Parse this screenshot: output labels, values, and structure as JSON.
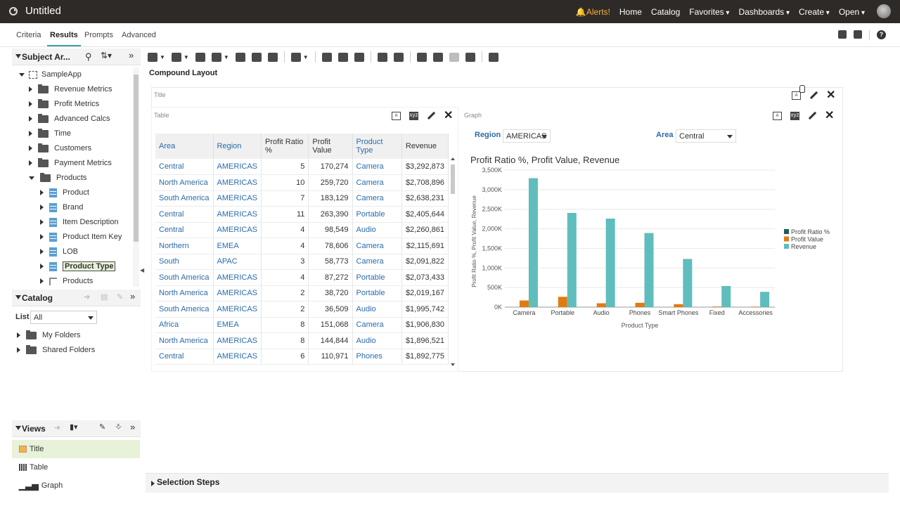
{
  "app": {
    "title": "Untitled"
  },
  "topnav": {
    "alerts": "Alerts!",
    "home": "Home",
    "catalog": "Catalog",
    "favorites": "Favorites",
    "dashboards": "Dashboards",
    "create": "Create",
    "open": "Open"
  },
  "tabs": [
    "Criteria",
    "Results",
    "Prompts",
    "Advanced"
  ],
  "subject_area": {
    "title": "Subject Ar...",
    "root": "SampleApp",
    "items": [
      {
        "label": "Revenue Metrics",
        "type": "folder",
        "level": 1,
        "expanded": false
      },
      {
        "label": "Profit Metrics",
        "type": "folder",
        "level": 1,
        "expanded": false
      },
      {
        "label": "Advanced Calcs",
        "type": "folder",
        "level": 1,
        "expanded": false
      },
      {
        "label": "Time",
        "type": "folder",
        "level": 1,
        "expanded": false
      },
      {
        "label": "Customers",
        "type": "folder",
        "level": 1,
        "expanded": false
      },
      {
        "label": "Payment Metrics",
        "type": "folder",
        "level": 1,
        "expanded": false
      },
      {
        "label": "Products",
        "type": "folder",
        "level": 1,
        "expanded": true
      },
      {
        "label": "Product",
        "type": "column",
        "level": 2,
        "expanded": false
      },
      {
        "label": "Brand",
        "type": "column",
        "level": 2,
        "expanded": false
      },
      {
        "label": "Item Description",
        "type": "column",
        "level": 2,
        "expanded": false
      },
      {
        "label": "Product Item Key",
        "type": "column",
        "level": 2,
        "expanded": false
      },
      {
        "label": "LOB",
        "type": "column",
        "level": 2,
        "expanded": false
      },
      {
        "label": "Product Type",
        "type": "column",
        "level": 2,
        "expanded": false,
        "selected": true
      },
      {
        "label": "Products",
        "type": "hierarchy",
        "level": 2,
        "expanded": false
      }
    ]
  },
  "catalog": {
    "title": "Catalog",
    "list_label": "List",
    "list_value": "All",
    "folders": [
      "My Folders",
      "Shared Folders"
    ]
  },
  "views": {
    "title": "Views",
    "items": [
      {
        "label": "Title",
        "selected": true
      },
      {
        "label": "Table",
        "selected": false
      },
      {
        "label": "Graph",
        "selected": false
      }
    ]
  },
  "layout": {
    "compound_label": "Compound Layout",
    "title_view_label": "Title",
    "table_view_label": "Table",
    "graph_view_label": "Graph"
  },
  "table": {
    "headers": [
      "Area",
      "Region",
      "Profit Ratio %",
      "Profit Value",
      "Product Type",
      "Revenue"
    ],
    "rows": [
      [
        "Central",
        "AMERICAS",
        "5",
        "170,274",
        "Camera",
        "$3,292,873"
      ],
      [
        "North America",
        "AMERICAS",
        "10",
        "259,720",
        "Camera",
        "$2,708,896"
      ],
      [
        "South America",
        "AMERICAS",
        "7",
        "183,129",
        "Camera",
        "$2,638,231"
      ],
      [
        "Central",
        "AMERICAS",
        "11",
        "263,390",
        "Portable",
        "$2,405,644"
      ],
      [
        "Central",
        "AMERICAS",
        "4",
        "98,549",
        "Audio",
        "$2,260,861"
      ],
      [
        "Northern",
        "EMEA",
        "4",
        "78,606",
        "Camera",
        "$2,115,691"
      ],
      [
        "South",
        "APAC",
        "3",
        "58,773",
        "Camera",
        "$2,091,822"
      ],
      [
        "South America",
        "AMERICAS",
        "4",
        "87,272",
        "Portable",
        "$2,073,433"
      ],
      [
        "North America",
        "AMERICAS",
        "2",
        "38,720",
        "Portable",
        "$2,019,167"
      ],
      [
        "South America",
        "AMERICAS",
        "2",
        "36,509",
        "Audio",
        "$1,995,742"
      ],
      [
        "Africa",
        "EMEA",
        "8",
        "151,068",
        "Camera",
        "$1,906,830"
      ],
      [
        "North America",
        "AMERICAS",
        "8",
        "144,844",
        "Audio",
        "$1,896,521"
      ],
      [
        "Central",
        "AMERICAS",
        "6",
        "110,971",
        "Phones",
        "$1,892,775"
      ]
    ]
  },
  "graph_prompts": {
    "region_label": "Region",
    "region_value": "AMERICAS",
    "area_label": "Area",
    "area_value": "Central"
  },
  "chart_data": {
    "type": "bar",
    "title": "Profit Ratio %, Profit Value, Revenue",
    "xlabel": "Product Type",
    "ylabel": "Profit Ratio %, Profit Value, Revenue",
    "categories": [
      "Camera",
      "Portable",
      "Audio",
      "Phones",
      "Smart Phones",
      "Fixed",
      "Accessories"
    ],
    "y_ticks": [
      "0K",
      "500K",
      "1,000K",
      "1,500K",
      "2,000K",
      "2,500K",
      "3,000K",
      "3,500K"
    ],
    "ylim": [
      0,
      3500000
    ],
    "legend_position": "right",
    "series": [
      {
        "name": "Profit Ratio %",
        "color": "#1f5c5c",
        "values": [
          5,
          11,
          4,
          6,
          3,
          2,
          2
        ]
      },
      {
        "name": "Profit Value",
        "color": "#e07b10",
        "values": [
          170274,
          263390,
          98549,
          110971,
          75000,
          15000,
          12000
        ]
      },
      {
        "name": "Revenue",
        "color": "#5fbdbd",
        "values": [
          3292873,
          2405644,
          2260861,
          1892775,
          1230000,
          540000,
          390000
        ]
      }
    ]
  },
  "selection_steps": {
    "label": "Selection Steps"
  }
}
